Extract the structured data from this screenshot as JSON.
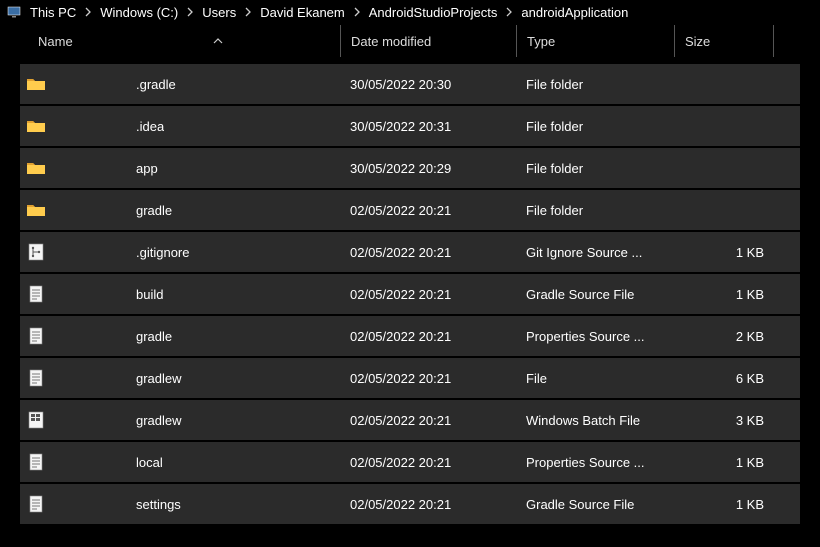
{
  "breadcrumb": {
    "items": [
      {
        "label": "This PC",
        "icon": "pc"
      },
      {
        "label": "Windows (C:)",
        "icon": null
      },
      {
        "label": "Users",
        "icon": null
      },
      {
        "label": "David Ekanem",
        "icon": null
      },
      {
        "label": "AndroidStudioProjects",
        "icon": null
      },
      {
        "label": "androidApplication",
        "icon": null
      }
    ]
  },
  "columns": {
    "name": "Name",
    "date": "Date modified",
    "type": "Type",
    "size": "Size",
    "sort_indicator": "name-asc"
  },
  "rows": [
    {
      "icon": "folder",
      "name": ".gradle",
      "date": "30/05/2022 20:30",
      "type": "File folder",
      "size": ""
    },
    {
      "icon": "folder",
      "name": ".idea",
      "date": "30/05/2022 20:31",
      "type": "File folder",
      "size": ""
    },
    {
      "icon": "folder",
      "name": "app",
      "date": "30/05/2022 20:29",
      "type": "File folder",
      "size": ""
    },
    {
      "icon": "folder",
      "name": "gradle",
      "date": "02/05/2022 20:21",
      "type": "File folder",
      "size": ""
    },
    {
      "icon": "git",
      "name": ".gitignore",
      "date": "02/05/2022 20:21",
      "type": "Git Ignore Source ...",
      "size": "1 KB"
    },
    {
      "icon": "file",
      "name": "build",
      "date": "02/05/2022 20:21",
      "type": "Gradle Source File",
      "size": "1 KB"
    },
    {
      "icon": "file",
      "name": "gradle",
      "date": "02/05/2022 20:21",
      "type": "Properties Source ...",
      "size": "2 KB"
    },
    {
      "icon": "file",
      "name": "gradlew",
      "date": "02/05/2022 20:21",
      "type": "File",
      "size": "6 KB"
    },
    {
      "icon": "bat",
      "name": "gradlew",
      "date": "02/05/2022 20:21",
      "type": "Windows Batch File",
      "size": "3 KB"
    },
    {
      "icon": "file",
      "name": "local",
      "date": "02/05/2022 20:21",
      "type": "Properties Source ...",
      "size": "1 KB"
    },
    {
      "icon": "file",
      "name": "settings",
      "date": "02/05/2022 20:21",
      "type": "Gradle Source File",
      "size": "1 KB"
    }
  ]
}
